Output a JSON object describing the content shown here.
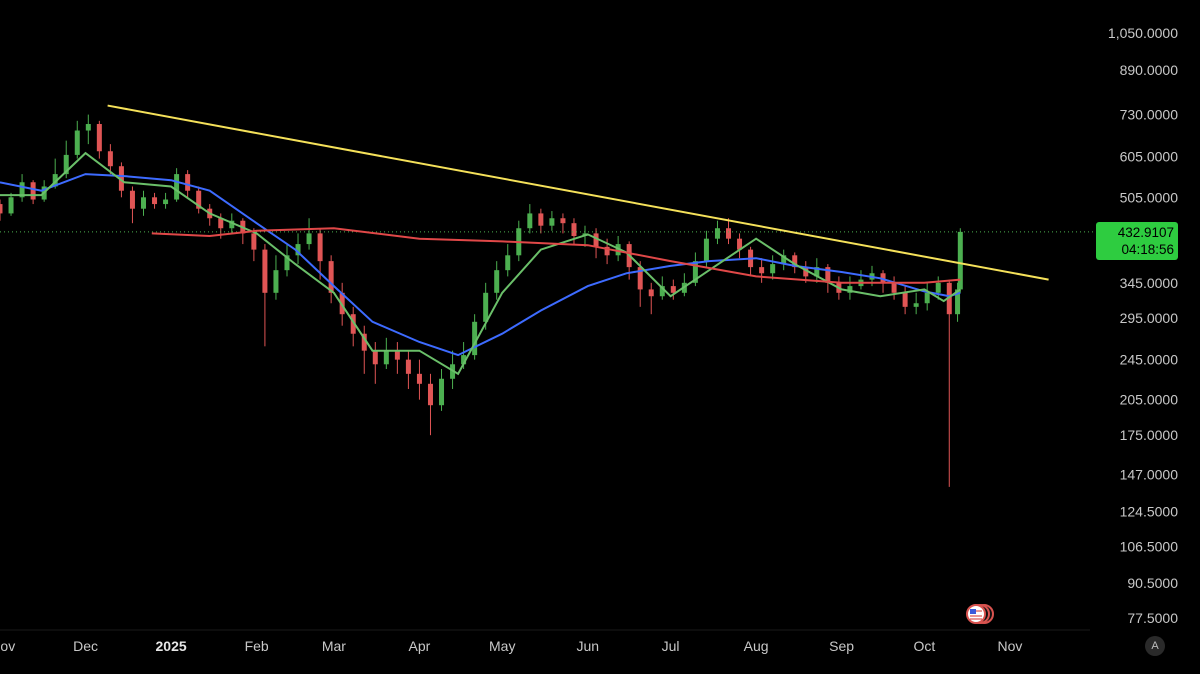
{
  "chart_data": {
    "type": "candlestick",
    "title": "",
    "scale": "log",
    "grid": false,
    "y_ticks": [
      "1,050.0000",
      "890.0000",
      "730.0000",
      "605.0000",
      "505.0000",
      "432.9107",
      "345.0000",
      "295.0000",
      "245.0000",
      "205.0000",
      "175.0000",
      "147.0000",
      "124.5000",
      "106.5000",
      "90.5000",
      "77.5000"
    ],
    "y_tick_values": [
      1050,
      890,
      730,
      605,
      505,
      345,
      295,
      245,
      205,
      175,
      147,
      124.5,
      106.5,
      90.5,
      77.5
    ],
    "x_ticks": [
      "Nov",
      "Dec",
      "2025",
      "Feb",
      "Mar",
      "Apr",
      "May",
      "Jun",
      "Jul",
      "Aug",
      "Sep",
      "Oct",
      "Nov"
    ],
    "x_tick_dates": [
      "2024-11-01",
      "2024-12-01",
      "2025-01-01",
      "2025-02-01",
      "2025-03-01",
      "2025-04-01",
      "2025-05-01",
      "2025-06-01",
      "2025-07-01",
      "2025-08-01",
      "2025-09-01",
      "2025-10-01",
      "2025-11-01"
    ],
    "x_range": [
      "2024-10-31",
      "2025-11-30"
    ],
    "current_price": "432.9107",
    "countdown": "04:18:56",
    "colors": {
      "up": "#4caf50",
      "down": "#e05555",
      "ma_short": "#6abf69",
      "ma_mid": "#3d6bff",
      "ma_long": "#e04848",
      "trendline": "#f5e15a",
      "price_line": "#4caf50",
      "price_tag": "#2ecc40"
    },
    "series": [
      {
        "type": "trendline",
        "points": [
          [
            "2024-12-09",
            760
          ],
          [
            "2025-11-15",
            350
          ]
        ]
      },
      {
        "type": "moving_average",
        "points": [
          [
            "2024-10-31",
            540
          ],
          [
            "2024-11-15",
            520
          ],
          [
            "2024-12-01",
            560
          ],
          [
            "2024-12-15",
            555
          ],
          [
            "2025-01-01",
            545
          ],
          [
            "2025-01-15",
            520
          ],
          [
            "2025-02-01",
            450
          ],
          [
            "2025-02-15",
            400
          ],
          [
            "2025-03-01",
            340
          ],
          [
            "2025-03-15",
            290
          ],
          [
            "2025-04-01",
            265
          ],
          [
            "2025-04-15",
            250
          ],
          [
            "2025-05-01",
            275
          ],
          [
            "2025-05-15",
            305
          ],
          [
            "2025-06-01",
            340
          ],
          [
            "2025-06-15",
            360
          ],
          [
            "2025-07-01",
            372
          ],
          [
            "2025-07-15",
            380
          ],
          [
            "2025-08-01",
            385
          ],
          [
            "2025-08-15",
            372
          ],
          [
            "2025-09-01",
            362
          ],
          [
            "2025-09-15",
            352
          ],
          [
            "2025-10-01",
            332
          ],
          [
            "2025-10-10",
            325
          ],
          [
            "2025-10-14",
            330
          ]
        ]
      },
      {
        "type": "moving_average",
        "points": [
          [
            "2024-10-31",
            510
          ],
          [
            "2024-11-15",
            510
          ],
          [
            "2024-12-01",
            615
          ],
          [
            "2024-12-15",
            540
          ],
          [
            "2025-01-01",
            530
          ],
          [
            "2025-01-15",
            470
          ],
          [
            "2025-02-01",
            430
          ],
          [
            "2025-02-15",
            375
          ],
          [
            "2025-03-01",
            330
          ],
          [
            "2025-03-15",
            255
          ],
          [
            "2025-04-01",
            255
          ],
          [
            "2025-04-15",
            230
          ],
          [
            "2025-05-01",
            330
          ],
          [
            "2025-05-15",
            400
          ],
          [
            "2025-06-01",
            428
          ],
          [
            "2025-06-15",
            395
          ],
          [
            "2025-07-01",
            325
          ],
          [
            "2025-07-15",
            365
          ],
          [
            "2025-08-01",
            420
          ],
          [
            "2025-08-15",
            375
          ],
          [
            "2025-09-01",
            335
          ],
          [
            "2025-09-15",
            325
          ],
          [
            "2025-10-01",
            335
          ],
          [
            "2025-10-08",
            318
          ],
          [
            "2025-10-14",
            335
          ]
        ]
      },
      {
        "type": "moving_average",
        "points": [
          [
            "2024-12-25",
            430
          ],
          [
            "2025-01-15",
            425
          ],
          [
            "2025-02-01",
            435
          ],
          [
            "2025-03-01",
            440
          ],
          [
            "2025-04-01",
            420
          ],
          [
            "2025-05-01",
            415
          ],
          [
            "2025-06-01",
            408
          ],
          [
            "2025-07-01",
            380
          ],
          [
            "2025-08-01",
            355
          ],
          [
            "2025-09-01",
            345
          ],
          [
            "2025-10-01",
            345
          ],
          [
            "2025-10-14",
            350
          ]
        ]
      }
    ],
    "candles": [
      [
        "2024-10-31",
        490,
        470,
        500,
        455
      ],
      [
        "2024-11-04",
        470,
        505,
        515,
        465
      ],
      [
        "2024-11-08",
        505,
        540,
        560,
        495
      ],
      [
        "2024-11-12",
        540,
        500,
        545,
        490
      ],
      [
        "2024-11-16",
        500,
        530,
        545,
        495
      ],
      [
        "2024-11-20",
        530,
        560,
        600,
        525
      ],
      [
        "2024-11-24",
        560,
        610,
        650,
        550
      ],
      [
        "2024-11-28",
        610,
        680,
        710,
        600
      ],
      [
        "2024-12-02",
        680,
        700,
        730,
        640
      ],
      [
        "2024-12-06",
        700,
        620,
        710,
        600
      ],
      [
        "2024-12-10",
        620,
        580,
        640,
        560
      ],
      [
        "2024-12-14",
        580,
        520,
        590,
        505
      ],
      [
        "2024-12-18",
        520,
        480,
        530,
        450
      ],
      [
        "2024-12-22",
        480,
        505,
        520,
        465
      ],
      [
        "2024-12-26",
        505,
        490,
        515,
        480
      ],
      [
        "2024-12-30",
        490,
        500,
        515,
        480
      ],
      [
        "2025-01-03",
        500,
        560,
        575,
        495
      ],
      [
        "2025-01-07",
        560,
        520,
        570,
        505
      ],
      [
        "2025-01-11",
        520,
        480,
        530,
        470
      ],
      [
        "2025-01-15",
        480,
        460,
        490,
        445
      ],
      [
        "2025-01-19",
        460,
        440,
        470,
        420
      ],
      [
        "2025-01-23",
        440,
        455,
        470,
        430
      ],
      [
        "2025-01-27",
        455,
        430,
        460,
        410
      ],
      [
        "2025-01-31",
        430,
        400,
        440,
        380
      ],
      [
        "2025-02-04",
        400,
        330,
        410,
        260
      ],
      [
        "2025-02-08",
        330,
        365,
        390,
        320
      ],
      [
        "2025-02-12",
        365,
        390,
        410,
        355
      ],
      [
        "2025-02-16",
        390,
        410,
        430,
        375
      ],
      [
        "2025-02-20",
        410,
        430,
        460,
        400
      ],
      [
        "2025-02-24",
        430,
        380,
        440,
        350
      ],
      [
        "2025-02-28",
        380,
        330,
        390,
        315
      ],
      [
        "2025-03-04",
        330,
        300,
        345,
        285
      ],
      [
        "2025-03-08",
        300,
        275,
        310,
        260
      ],
      [
        "2025-03-12",
        275,
        255,
        285,
        230
      ],
      [
        "2025-03-16",
        255,
        240,
        265,
        220
      ],
      [
        "2025-03-20",
        240,
        255,
        270,
        235
      ],
      [
        "2025-03-24",
        255,
        245,
        265,
        230
      ],
      [
        "2025-03-28",
        245,
        230,
        255,
        215
      ],
      [
        "2025-04-01",
        230,
        220,
        245,
        205
      ],
      [
        "2025-04-05",
        220,
        200,
        230,
        175
      ],
      [
        "2025-04-09",
        200,
        225,
        235,
        195
      ],
      [
        "2025-04-13",
        225,
        240,
        255,
        215
      ],
      [
        "2025-04-17",
        240,
        250,
        265,
        235
      ],
      [
        "2025-04-21",
        250,
        290,
        300,
        245
      ],
      [
        "2025-04-25",
        290,
        330,
        345,
        280
      ],
      [
        "2025-04-29",
        330,
        365,
        380,
        320
      ],
      [
        "2025-05-03",
        365,
        390,
        410,
        355
      ],
      [
        "2025-05-07",
        390,
        440,
        455,
        380
      ],
      [
        "2025-05-11",
        440,
        470,
        490,
        430
      ],
      [
        "2025-05-15",
        470,
        445,
        480,
        430
      ],
      [
        "2025-05-19",
        445,
        460,
        475,
        435
      ],
      [
        "2025-05-23",
        460,
        450,
        470,
        430
      ],
      [
        "2025-05-27",
        450,
        425,
        460,
        410
      ],
      [
        "2025-05-31",
        425,
        430,
        445,
        405
      ],
      [
        "2025-06-04",
        430,
        405,
        440,
        385
      ],
      [
        "2025-06-08",
        405,
        390,
        420,
        375
      ],
      [
        "2025-06-12",
        390,
        410,
        425,
        380
      ],
      [
        "2025-06-16",
        410,
        370,
        415,
        350
      ],
      [
        "2025-06-20",
        370,
        335,
        380,
        310
      ],
      [
        "2025-06-24",
        335,
        325,
        345,
        300
      ],
      [
        "2025-06-28",
        325,
        340,
        355,
        320
      ],
      [
        "2025-07-02",
        340,
        330,
        350,
        320
      ],
      [
        "2025-07-06",
        330,
        345,
        360,
        325
      ],
      [
        "2025-07-10",
        345,
        380,
        395,
        340
      ],
      [
        "2025-07-14",
        380,
        420,
        435,
        370
      ],
      [
        "2025-07-18",
        420,
        440,
        455,
        410
      ],
      [
        "2025-07-22",
        440,
        420,
        460,
        410
      ],
      [
        "2025-07-26",
        420,
        400,
        430,
        385
      ],
      [
        "2025-07-30",
        400,
        370,
        405,
        355
      ],
      [
        "2025-08-03",
        370,
        360,
        385,
        345
      ],
      [
        "2025-08-07",
        360,
        375,
        390,
        350
      ],
      [
        "2025-08-11",
        375,
        390,
        400,
        365
      ],
      [
        "2025-08-15",
        390,
        370,
        395,
        360
      ],
      [
        "2025-08-19",
        370,
        355,
        380,
        345
      ],
      [
        "2025-08-23",
        355,
        370,
        385,
        345
      ],
      [
        "2025-08-27",
        370,
        345,
        375,
        330
      ],
      [
        "2025-08-31",
        345,
        330,
        355,
        320
      ],
      [
        "2025-09-04",
        330,
        340,
        355,
        320
      ],
      [
        "2025-09-08",
        340,
        350,
        365,
        335
      ],
      [
        "2025-09-12",
        350,
        360,
        372,
        340
      ],
      [
        "2025-09-16",
        360,
        345,
        365,
        330
      ],
      [
        "2025-09-20",
        345,
        330,
        355,
        320
      ],
      [
        "2025-09-24",
        330,
        310,
        340,
        300
      ],
      [
        "2025-09-28",
        310,
        315,
        330,
        300
      ],
      [
        "2025-10-02",
        315,
        330,
        345,
        305
      ],
      [
        "2025-10-06",
        330,
        345,
        355,
        320
      ],
      [
        "2025-10-10",
        345,
        300,
        350,
        139
      ],
      [
        "2025-10-13",
        300,
        335,
        345,
        290
      ],
      [
        "2025-10-14",
        335,
        432.9,
        440,
        330
      ]
    ]
  },
  "scale_mode_label": "A"
}
